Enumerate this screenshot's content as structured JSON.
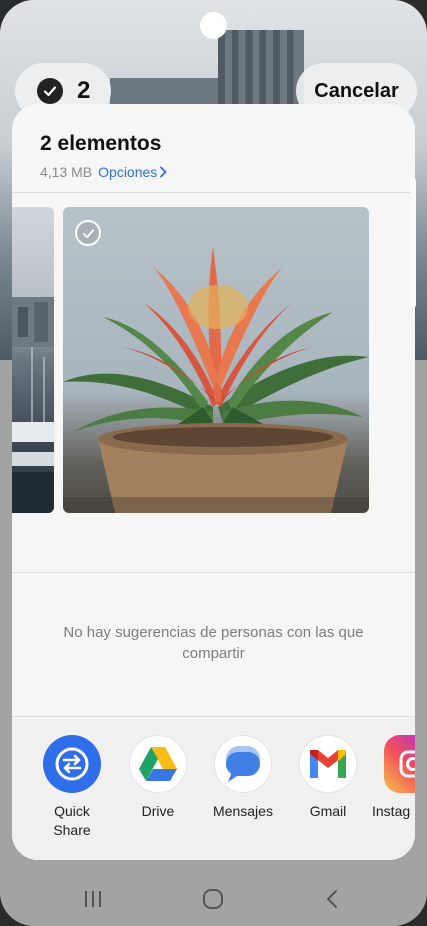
{
  "top_bar": {
    "selected_count": "2",
    "cancel_label": "Cancelar"
  },
  "sheet": {
    "title": "2 elementos",
    "size": "4,13 MB",
    "options_label": "Opciones",
    "no_suggestions": "No hay sugerencias de personas con las que compartir"
  },
  "apps": [
    {
      "label": "Quick\nShare",
      "icon": "quick-share-icon",
      "color": "#2f6ee8"
    },
    {
      "label": "Drive",
      "icon": "google-drive-icon"
    },
    {
      "label": "Mensajes",
      "icon": "messages-icon",
      "color": "#3f7fe6"
    },
    {
      "label": "Gmail",
      "icon": "gmail-icon"
    },
    {
      "label": "Instag",
      "icon": "instagram-icon"
    }
  ],
  "colors": {
    "accent": "#2f6fd6",
    "sheet_bg": "#f6f6f6"
  }
}
